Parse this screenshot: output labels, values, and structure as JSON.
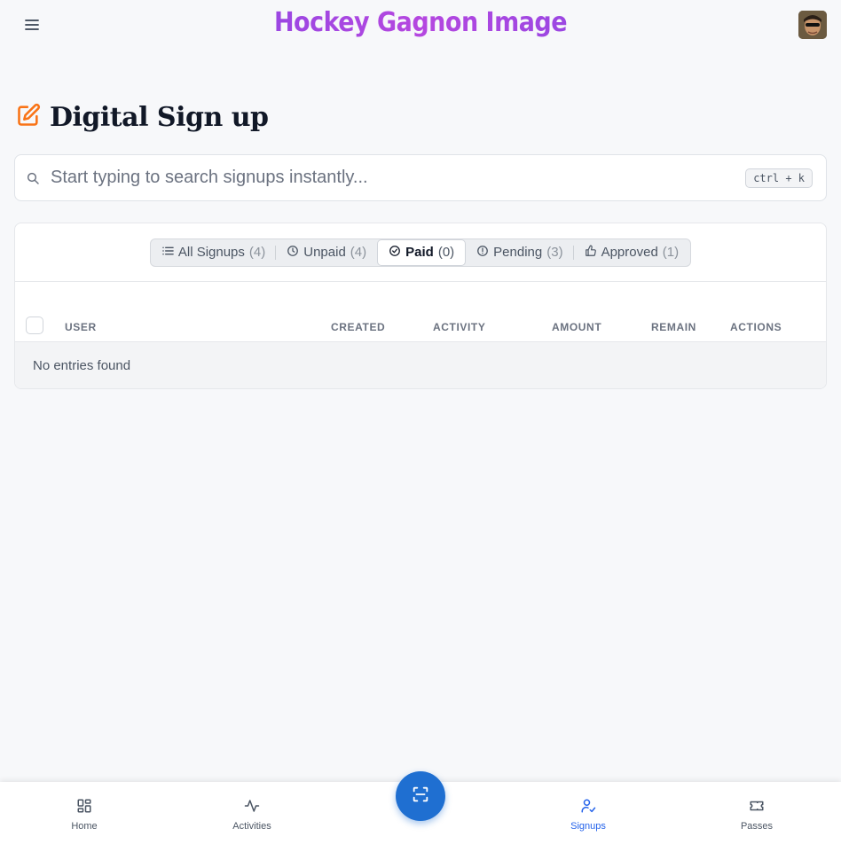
{
  "header": {
    "brand": "Hockey Gagnon Image",
    "menu_icon": "hamburger-menu-icon",
    "avatar_icon": "user-avatar"
  },
  "page": {
    "title": "Digital Sign up",
    "title_icon": "pencil-square-icon",
    "accent_color": "#f97316"
  },
  "search": {
    "placeholder": "Start typing to search signups instantly...",
    "shortcut": "ctrl + k"
  },
  "tabs": [
    {
      "label": "All Signups",
      "count": "(4)",
      "icon": "list-icon"
    },
    {
      "label": "Unpaid",
      "count": "(4)",
      "icon": "clock-icon"
    },
    {
      "label": "Paid",
      "count": "(0)",
      "icon": "check-circle-icon",
      "active": true
    },
    {
      "label": "Pending",
      "count": "(3)",
      "icon": "alert-circle-icon"
    },
    {
      "label": "Approved",
      "count": "(1)",
      "icon": "thumbs-up-icon"
    }
  ],
  "table": {
    "columns": [
      "USER",
      "CREATED",
      "ACTIVITY",
      "AMOUNT",
      "REMAIN",
      "ACTIONS"
    ],
    "empty_message": "No entries found"
  },
  "bottom_nav": {
    "items": [
      {
        "label": "Home",
        "icon": "grid-icon"
      },
      {
        "label": "Activities",
        "icon": "activity-icon"
      },
      {
        "label": "Signups",
        "icon": "user-check-icon",
        "active": true
      },
      {
        "label": "Passes",
        "icon": "ticket-icon"
      }
    ],
    "scan_icon": "scan-icon",
    "active_color": "#2563eb",
    "fab_color": "#1f6fd1"
  }
}
